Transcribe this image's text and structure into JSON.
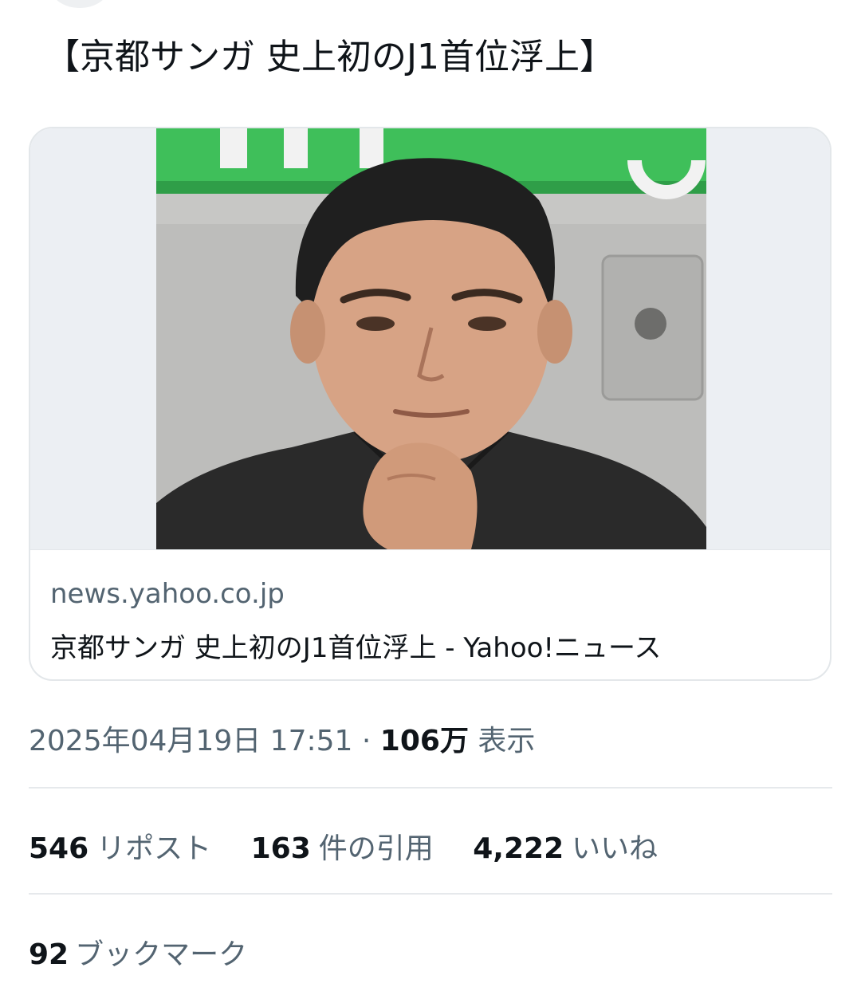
{
  "tweet": {
    "text": "【京都サンガ 史上初のJ1首位浮上】"
  },
  "card": {
    "domain": "news.yahoo.co.jp",
    "title": "京都サンガ 史上初のJ1首位浮上 - Yahoo!ニュース"
  },
  "meta": {
    "timestamp": "2025年04月19日 17:51",
    "dot": "·",
    "views_count": "106万",
    "views_label": "表示"
  },
  "stats": {
    "reposts_count": "546",
    "reposts_label": "リポスト",
    "quotes_count": "163",
    "quotes_label": "件の引用",
    "likes_count": "4,222",
    "likes_label": "いいね",
    "bookmarks_count": "92",
    "bookmarks_label": "ブックマーク"
  },
  "colors": {
    "text_primary": "#0f1419",
    "text_secondary": "#536471",
    "border": "#e3e7ea",
    "photo_green": "#3fbf5a"
  }
}
